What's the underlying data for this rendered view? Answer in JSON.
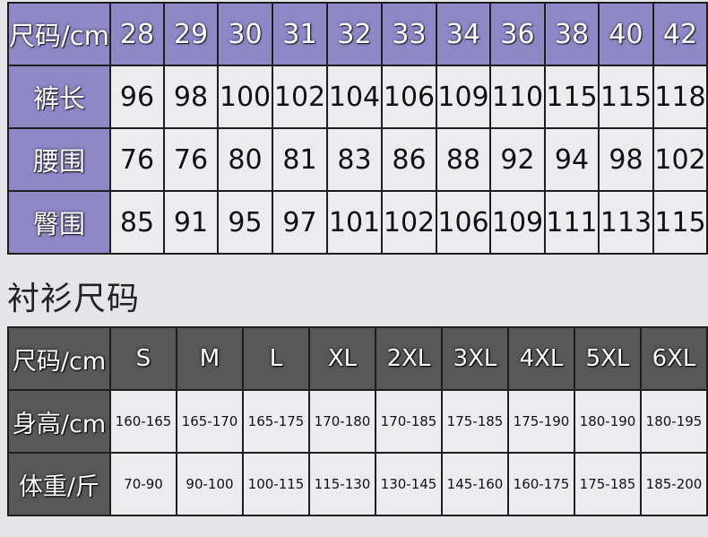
{
  "pants": {
    "header_label": "尺码/cm",
    "sizes": [
      "28",
      "29",
      "30",
      "31",
      "32",
      "33",
      "34",
      "36",
      "38",
      "40",
      "42"
    ],
    "rows": [
      {
        "label": "裤长",
        "values": [
          "96",
          "98",
          "100",
          "102",
          "104",
          "106",
          "109",
          "110",
          "115",
          "115",
          "118"
        ]
      },
      {
        "label": "腰围",
        "values": [
          "76",
          "76",
          "80",
          "81",
          "83",
          "86",
          "88",
          "92",
          "94",
          "98",
          "102"
        ]
      },
      {
        "label": "臀围",
        "values": [
          "85",
          "91",
          "95",
          "97",
          "101",
          "102",
          "106",
          "109",
          "111",
          "113",
          "115"
        ]
      }
    ]
  },
  "shirt": {
    "title": "衬衫尺码",
    "header_label": "尺码/cm",
    "sizes": [
      "S",
      "M",
      "L",
      "XL",
      "2XL",
      "3XL",
      "4XL",
      "5XL",
      "6XL"
    ],
    "rows": [
      {
        "label": "身高/cm",
        "values": [
          "160-165",
          "165-170",
          "165-175",
          "170-180",
          "170-185",
          "175-185",
          "175-190",
          "180-190",
          "180-195"
        ]
      },
      {
        "label": "体重/斤",
        "values": [
          "70-90",
          "90-100",
          "100-115",
          "115-130",
          "130-145",
          "145-160",
          "160-175",
          "175-185",
          "185-200"
        ]
      }
    ]
  },
  "colors": {
    "pants_header_bg": "#8e88c6",
    "shirt_header_bg": "#585859",
    "cell_bg": "#ececee",
    "page_bg": "#e5e5e7"
  }
}
